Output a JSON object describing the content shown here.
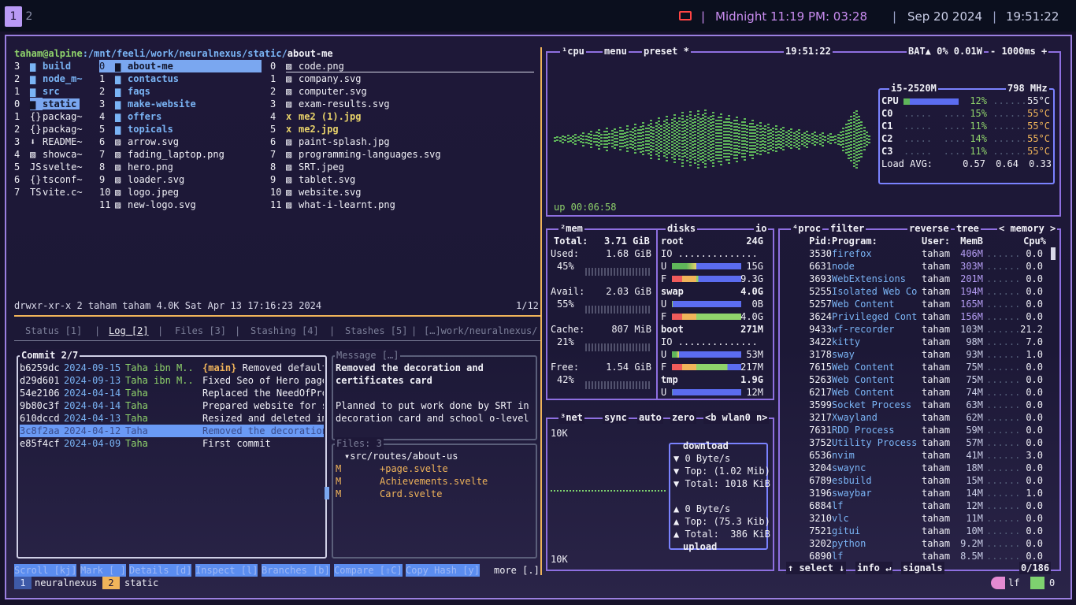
{
  "topbar": {
    "workspaces": [
      "1",
      "2"
    ],
    "clock_label": "Midnight 11:19 PM: 03:28",
    "date": "Sep 20 2024",
    "separator": "|",
    "time": "19:51:22"
  },
  "lf": {
    "path_user": "taham@alpine",
    "path_rest": ":/mnt/feeli/work/neuralnexus/static/",
    "path_current": "about-me",
    "col1": [
      [
        "3",
        "build"
      ],
      [
        "2",
        "node_m~"
      ],
      [
        "1",
        "src"
      ],
      [
        "0",
        "static"
      ],
      [
        "1",
        "packag~"
      ],
      [
        "2",
        "packag~"
      ],
      [
        "3",
        "README~"
      ],
      [
        "4",
        "showca~"
      ],
      [
        "5",
        "svelte~"
      ],
      [
        "6",
        "tsconf~"
      ],
      [
        "7",
        "vite.c~"
      ]
    ],
    "col2": [
      [
        "0",
        "about-me"
      ],
      [
        "1",
        "contactus"
      ],
      [
        "2",
        "faqs"
      ],
      [
        "3",
        "make-website"
      ],
      [
        "4",
        "offers"
      ],
      [
        "5",
        "topicals"
      ],
      [
        "6",
        "arrow.svg"
      ],
      [
        "7",
        "fading_laptop.png"
      ],
      [
        "8",
        "hero.png"
      ],
      [
        "9",
        "loader.svg"
      ],
      [
        "10",
        "logo.jpeg"
      ],
      [
        "11",
        "new-logo.svg"
      ]
    ],
    "col3": [
      [
        "0",
        "code.png"
      ],
      [
        "1",
        "company.svg"
      ],
      [
        "2",
        "computer.svg"
      ],
      [
        "3",
        "exam-results.svg"
      ],
      [
        "4",
        "me2 (1).jpg"
      ],
      [
        "5",
        "me2.jpg"
      ],
      [
        "6",
        "paint-splash.jpg"
      ],
      [
        "7",
        "programming-languages.svg"
      ],
      [
        "8",
        "SRT.jpeg"
      ],
      [
        "9",
        "tablet.svg"
      ],
      [
        "10",
        "website.svg"
      ],
      [
        "11",
        "what-i-learnt.png"
      ]
    ],
    "status": "drwxr-xr-x 2 taham taham 4.0K Sat Apr 13 17:16:23 2024",
    "position": "1/12"
  },
  "gitui": {
    "tabs": [
      "Status [1]",
      "Log [2]",
      "Files [3]",
      "Stashing [4]",
      "Stashes [5]",
      "[…]work/neuralnexus/"
    ],
    "commit_title": "Commit 2/7",
    "commits": [
      {
        "hash": "b6259dc",
        "date": "2024-09-15",
        "author": "Taha ibn M..",
        "msg": "{main} Removed default"
      },
      {
        "hash": "d29d601",
        "date": "2024-09-13",
        "author": "Taha ibn M..",
        "msg": "Fixed Seo of Hero page"
      },
      {
        "hash": "54e2106",
        "date": "2024-04-14",
        "author": "Taha",
        "msg": "Replaced the NeedOfPro"
      },
      {
        "hash": "9b80c3f",
        "date": "2024-04-14",
        "author": "Taha",
        "msg": "Prepared website for s"
      },
      {
        "hash": "610dccd",
        "date": "2024-04-13",
        "author": "Taha",
        "msg": "Resized and deleted im"
      },
      {
        "hash": "3c8f2aa",
        "date": "2024-04-12",
        "author": "Taha",
        "msg": "Removed the decoration"
      },
      {
        "hash": "e85f4cf",
        "date": "2024-04-09",
        "author": "Taha",
        "msg": "First commit"
      }
    ],
    "message_title": "Message […]",
    "message_lines": [
      "Removed the decoration and",
      "certificates card",
      "",
      "Planned to put work done by SRT in",
      "decoration card and school o-level"
    ],
    "files_title": "Files: 3",
    "files_dir": "▾src/routes/about-us",
    "files": [
      [
        "M",
        "+page.svelte"
      ],
      [
        "M",
        "Achievements.svelte"
      ],
      [
        "M",
        "Card.svelte"
      ]
    ],
    "keys": [
      "Scroll [kj]",
      "Mark [ ]",
      "Details [d]",
      "Inspect [l]",
      "Branches [b]",
      "Compare [⇧C]",
      "Copy Hash [y]",
      "more [.]"
    ]
  },
  "tmux": {
    "windows": [
      [
        "1",
        "neuralnexus"
      ],
      [
        "2",
        "static"
      ]
    ],
    "right": "lf",
    "right_num": "0"
  },
  "btop": {
    "cpu": {
      "header": [
        "¹cpu",
        "menu",
        "preset *",
        "19:51:22",
        "BAT▲ 0% 0.01W",
        "- 1000ms +"
      ],
      "model": "i5-2520M",
      "freq": "798 MHz",
      "rows": [
        [
          "CPU",
          "12%",
          "55°C"
        ],
        [
          "C0",
          "15%",
          "55°C"
        ],
        [
          "C1",
          "11%",
          "55°C"
        ],
        [
          "C2",
          "14%",
          "55°C"
        ],
        [
          "C3",
          "11%",
          "55°C"
        ]
      ],
      "load_label": "Load AVG:",
      "load": [
        "0.57",
        "0.64",
        "0.33"
      ],
      "uptime": "up 00:06:58"
    },
    "mem": {
      "title": "²mem",
      "total_label": "Total:",
      "total": "3.71 GiB",
      "rows": [
        [
          "Used:",
          "1.68 GiB",
          "45%"
        ],
        [
          "Avail:",
          "2.03 GiB",
          "55%"
        ],
        [
          "Cache:",
          "807 MiB",
          "21%"
        ],
        [
          "Free:",
          "1.54 GiB",
          "42%"
        ]
      ]
    },
    "disks": {
      "title": "disks",
      "io": "io",
      "items": [
        {
          "name": "root",
          "size": "24G",
          "u": "15G",
          "f": "9.3G"
        },
        {
          "name": "swap",
          "size": "4.0G",
          "u": "0B",
          "f": "4.0G"
        },
        {
          "name": "boot",
          "size": "271M",
          "u": "53M",
          "f": "217M"
        },
        {
          "name": "tmp",
          "size": "1.9G",
          "u": "12M"
        }
      ]
    },
    "net": {
      "title": "³net",
      "tabs": [
        "sync",
        "auto",
        "zero",
        "<b wlan0 n>"
      ],
      "top_scale": "10K",
      "bottom_scale": "10K",
      "download": [
        "download",
        "▼ 0 Byte/s",
        "▼ Top: (1.02 Mib)",
        "▼ Total: 1018 KiB"
      ],
      "upload": [
        "▲ 0 Byte/s",
        "▲ Top: (75.3 Kib)",
        "▲ Total:  386 KiB",
        "upload"
      ]
    },
    "proc": {
      "header": [
        "⁴proc",
        "filter",
        "reverse",
        "tree",
        "< memory >"
      ],
      "columns": [
        "Pid:",
        "Program:",
        "User:",
        "MemB",
        "Cpu%"
      ],
      "rows": [
        [
          "3530",
          "firefox",
          "taham",
          "406M",
          "0.0"
        ],
        [
          "6631",
          "node",
          "taham",
          "303M",
          "0.0"
        ],
        [
          "3693",
          "WebExtensions",
          "taham",
          "201M",
          "0.0"
        ],
        [
          "5255",
          "Isolated Web Co",
          "taham",
          "194M",
          "0.0"
        ],
        [
          "5257",
          "Web Content",
          "taham",
          "165M",
          "0.0"
        ],
        [
          "3624",
          "Privileged Cont",
          "taham",
          "156M",
          "0.0"
        ],
        [
          "9433",
          "wf-recorder",
          "taham",
          "103M",
          "21.2"
        ],
        [
          "3422",
          "kitty",
          "taham",
          "98M",
          "7.0"
        ],
        [
          "3178",
          "sway",
          "taham",
          "93M",
          "1.0"
        ],
        [
          "7615",
          "Web Content",
          "taham",
          "75M",
          "0.0"
        ],
        [
          "5263",
          "Web Content",
          "taham",
          "75M",
          "0.0"
        ],
        [
          "6217",
          "Web Content",
          "taham",
          "74M",
          "0.0"
        ],
        [
          "3599",
          "Socket Process",
          "taham",
          "63M",
          "0.0"
        ],
        [
          "3217",
          "Xwayland",
          "taham",
          "62M",
          "0.0"
        ],
        [
          "7631",
          "RDD Process",
          "taham",
          "59M",
          "0.0"
        ],
        [
          "3752",
          "Utility Process",
          "taham",
          "57M",
          "0.0"
        ],
        [
          "6536",
          "nvim",
          "taham",
          "41M",
          "3.0"
        ],
        [
          "3204",
          "swaync",
          "taham",
          "18M",
          "0.0"
        ],
        [
          "6789",
          "esbuild",
          "taham",
          "15M",
          "0.0"
        ],
        [
          "3196",
          "swaybar",
          "taham",
          "14M",
          "1.0"
        ],
        [
          "6884",
          "lf",
          "taham",
          "12M",
          "0.0"
        ],
        [
          "3210",
          "vlc",
          "taham",
          "11M",
          "0.0"
        ],
        [
          "7521",
          "gitui",
          "taham",
          "10M",
          "0.0"
        ],
        [
          "3202",
          "python",
          "taham",
          "9.2M",
          "0.0"
        ],
        [
          "6890",
          "lf",
          "taham",
          "8.5M",
          "0.0"
        ]
      ],
      "footer": [
        "↑ select ↓",
        "info ↵",
        "signals",
        "0/186"
      ]
    }
  }
}
